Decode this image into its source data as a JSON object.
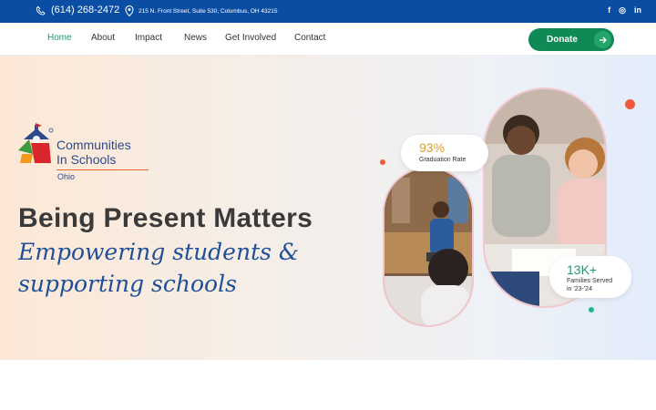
{
  "topbar": {
    "phone": "(614) 268-2472",
    "address": "215 N. Front Street, Suite 530, Columbus, OH 43215",
    "social": [
      "facebook-icon",
      "instagram-icon",
      "linkedin-icon"
    ],
    "social_glyphs": [
      "f",
      "◎",
      "in"
    ]
  },
  "nav": {
    "items": [
      "Home",
      "About",
      "Impact",
      "News",
      "Get Involved",
      "Contact"
    ],
    "active": "Home",
    "donate_label": "Donate"
  },
  "logo": {
    "line1": "Communities",
    "line2": "In Schools",
    "line3": "Ohio"
  },
  "hero": {
    "headline": "Being Present Matters",
    "script_line1": "Empowering students &",
    "script_line2": "supporting schools"
  },
  "stats": [
    {
      "value": "93%",
      "caption": "Graduation Rate"
    },
    {
      "value": "13K+",
      "caption_line1": "Families Served",
      "caption_line2": "in '23-'24"
    }
  ],
  "colors": {
    "topbar": "#0a4ea3",
    "accent_green": "#0f8a55",
    "stat_orange": "#e0a02a",
    "stat_green": "#1a9b6e",
    "headline": "#3a3a3a",
    "script": "#1f4f98"
  }
}
